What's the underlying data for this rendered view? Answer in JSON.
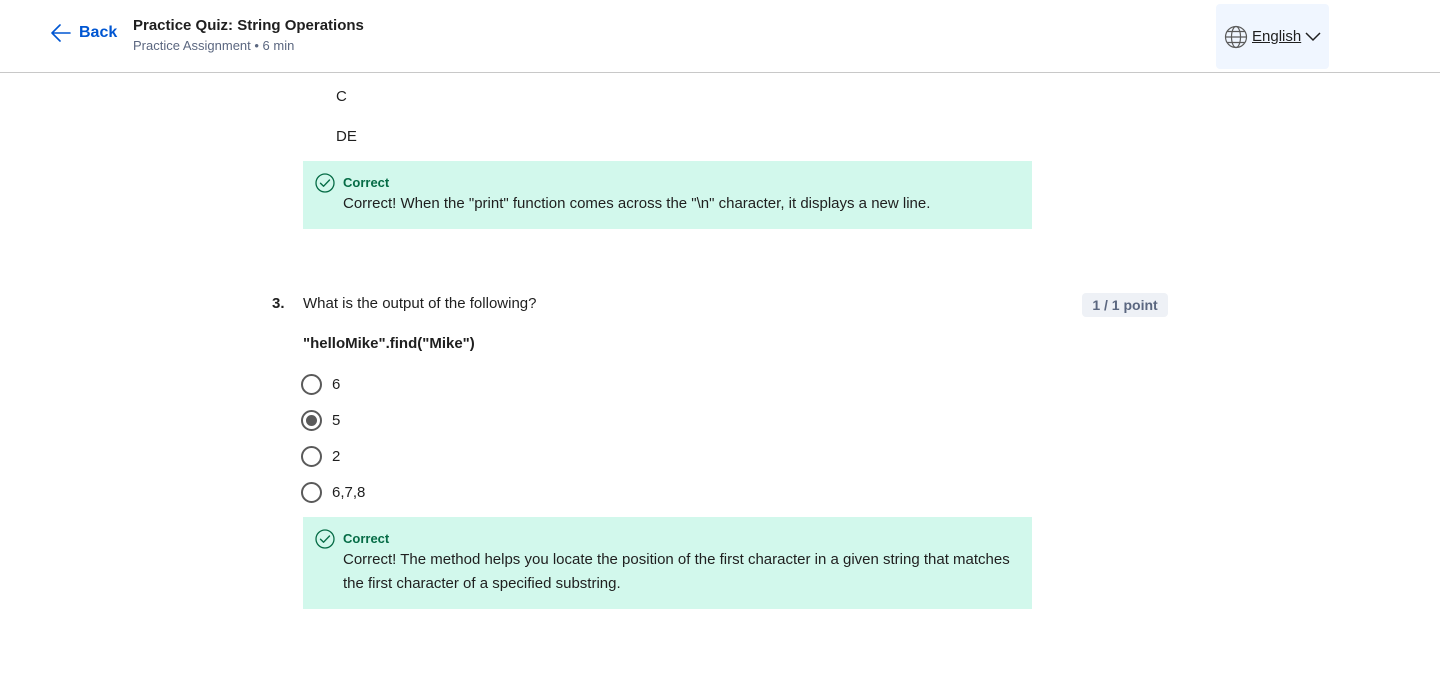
{
  "header": {
    "back_label": "Back",
    "title": "Practice Quiz: String Operations",
    "meta": "Practice Assignment • 6 min",
    "language": "English"
  },
  "prev_question": {
    "answer_lines": [
      "C",
      "DE"
    ],
    "feedback": {
      "title": "Correct",
      "text": "Correct! When the \"print\" function comes across the \"\\n\" character, it displays a new line."
    }
  },
  "question3": {
    "number": "3.",
    "text": "What is the output of the following?",
    "points": "1 / 1 point",
    "code": "\"helloMike\".find(\"Mike\")",
    "options": [
      {
        "label": "6",
        "selected": false
      },
      {
        "label": "5",
        "selected": true
      },
      {
        "label": "2",
        "selected": false
      },
      {
        "label": "6,7,8",
        "selected": false
      }
    ],
    "feedback": {
      "title": "Correct",
      "text": "Correct! The method helps you locate the position of the first character in a given string that matches the first character of a specified substring."
    }
  },
  "colors": {
    "link": "#0056d2",
    "correct_bg": "#d2f8ec",
    "correct_text": "#066c46"
  }
}
